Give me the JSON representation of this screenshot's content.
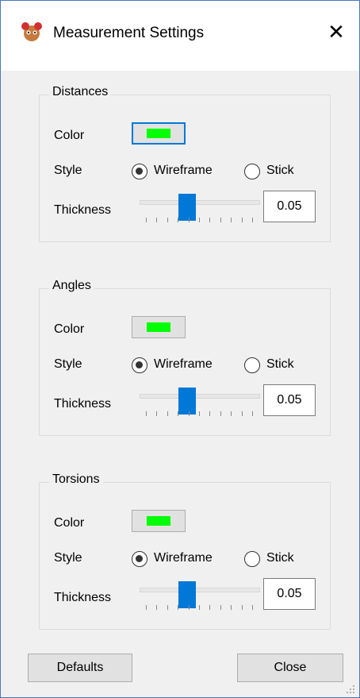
{
  "window": {
    "title": "Measurement Settings",
    "close_glyph": "✕"
  },
  "groups": [
    {
      "title": "Distances",
      "color_label": "Color",
      "color": "#00ff00",
      "style_label": "Style",
      "style_options": [
        "Wireframe",
        "Stick"
      ],
      "style_selected": "Wireframe",
      "thickness_label": "Thickness",
      "thickness_value": "0.05",
      "thickness_slider_fraction": 0.4,
      "focused": true
    },
    {
      "title": "Angles",
      "color_label": "Color",
      "color": "#00ff00",
      "style_label": "Style",
      "style_options": [
        "Wireframe",
        "Stick"
      ],
      "style_selected": "Wireframe",
      "thickness_label": "Thickness",
      "thickness_value": "0.05",
      "thickness_slider_fraction": 0.4,
      "focused": false
    },
    {
      "title": "Torsions",
      "color_label": "Color",
      "color": "#00ff00",
      "style_label": "Style",
      "style_options": [
        "Wireframe",
        "Stick"
      ],
      "style_selected": "Wireframe",
      "thickness_label": "Thickness",
      "thickness_value": "0.05",
      "thickness_slider_fraction": 0.4,
      "focused": false
    }
  ],
  "buttons": {
    "defaults": "Defaults",
    "close": "Close"
  },
  "icons": {
    "app": "molecule-app-icon",
    "close": "close-icon",
    "resize": "resize-grip-icon"
  }
}
